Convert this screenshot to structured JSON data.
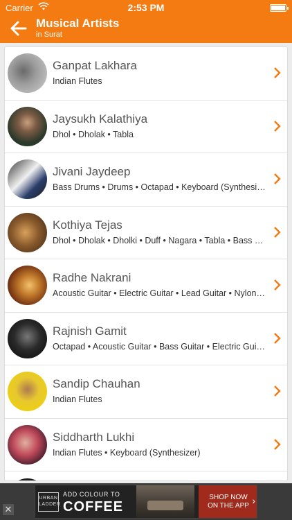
{
  "status_bar": {
    "carrier": "Carrier",
    "time": "2:53 PM"
  },
  "navbar": {
    "title": "Musical Artists",
    "subtitle": "in Surat"
  },
  "artists": [
    {
      "name": "Ganpat Lakhara",
      "instruments": "Indian Flutes"
    },
    {
      "name": "Jaysukh Kalathiya",
      "instruments": "Dhol • Dholak • Tabla"
    },
    {
      "name": "Jivani Jaydeep",
      "instruments": "Bass Drums • Drums • Octapad • Keyboard (Synthesize..."
    },
    {
      "name": "Kothiya Tejas",
      "instruments": "Dhol • Dholak • Dholki • Duff • Nagara • Tabla • Bass Dr..."
    },
    {
      "name": "Radhe Nakrani",
      "instruments": "Acoustic Guitar • Electric Guitar • Lead Guitar • Nylon S..."
    },
    {
      "name": "Rajnish Gamit",
      "instruments": "Octapad • Acoustic Guitar • Bass Guitar • Electric Guita..."
    },
    {
      "name": "Sandip Chauhan",
      "instruments": "Indian Flutes"
    },
    {
      "name": "Siddharth Lukhi",
      "instruments": "Indian Flutes • Keyboard (Synthesizer)"
    }
  ],
  "ad": {
    "brand_line1": "URBAN",
    "brand_line2": "LADDER",
    "tagline": "ADD COLOUR TO",
    "headline": "COFFEE",
    "cta_line1": "SHOP NOW",
    "cta_line2": "ON THE APP",
    "close_label": "✕"
  },
  "colors": {
    "accent": "#f47b12",
    "chevron": "#f47b12"
  },
  "icons": {
    "back": "back-arrow-icon",
    "chevron": "chevron-right-icon",
    "wifi": "wifi-icon",
    "battery": "battery-icon"
  }
}
